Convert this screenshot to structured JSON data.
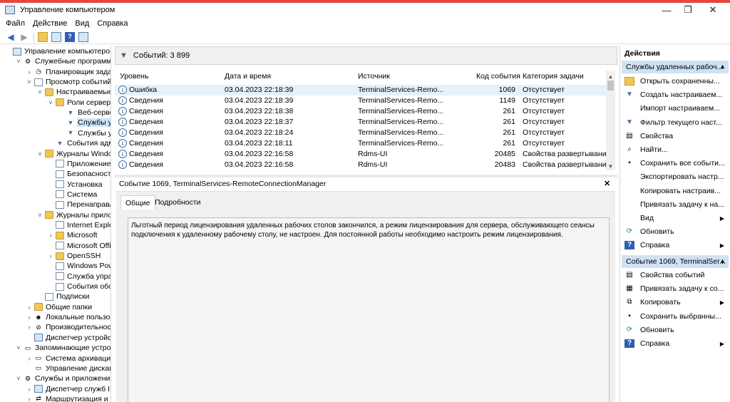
{
  "window": {
    "title": "Управление компьютером",
    "controls": {
      "minimize": "—",
      "maximize": "❐",
      "close": "✕"
    }
  },
  "menu": [
    "Файл",
    "Действие",
    "Вид",
    "Справка"
  ],
  "tree": [
    {
      "label": "Управление компьютером (л",
      "depth": 0,
      "twisty": "",
      "icon": "comp"
    },
    {
      "label": "Служебные программы",
      "depth": 1,
      "twisty": "˅",
      "icon": "tool"
    },
    {
      "label": "Планировщик заданий",
      "depth": 2,
      "twisty": "›",
      "icon": "clock"
    },
    {
      "label": "Просмотр событий",
      "depth": 2,
      "twisty": "˅",
      "icon": "log"
    },
    {
      "label": "Настраиваемые пр",
      "depth": 3,
      "twisty": "˅",
      "icon": "folder"
    },
    {
      "label": "Роли сервера",
      "depth": 4,
      "twisty": "˅",
      "icon": "folder"
    },
    {
      "label": "Веб-сервер",
      "depth": 5,
      "twisty": "",
      "icon": "filter"
    },
    {
      "label": "Службы уда",
      "depth": 5,
      "twisty": "",
      "icon": "filter",
      "selected": true
    },
    {
      "label": "Службы уда",
      "depth": 5,
      "twisty": "",
      "icon": "filter"
    },
    {
      "label": "События админ",
      "depth": 4,
      "twisty": "",
      "icon": "filter"
    },
    {
      "label": "Журналы Windows",
      "depth": 3,
      "twisty": "˅",
      "icon": "folder"
    },
    {
      "label": "Приложение",
      "depth": 4,
      "twisty": "",
      "icon": "log"
    },
    {
      "label": "Безопасность",
      "depth": 4,
      "twisty": "",
      "icon": "log"
    },
    {
      "label": "Установка",
      "depth": 4,
      "twisty": "",
      "icon": "log"
    },
    {
      "label": "Система",
      "depth": 4,
      "twisty": "",
      "icon": "log"
    },
    {
      "label": "Перенаправлен",
      "depth": 4,
      "twisty": "",
      "icon": "log"
    },
    {
      "label": "Журналы приложе",
      "depth": 3,
      "twisty": "˅",
      "icon": "folder"
    },
    {
      "label": "Internet Explorer",
      "depth": 4,
      "twisty": "",
      "icon": "log"
    },
    {
      "label": "Microsoft",
      "depth": 4,
      "twisty": "›",
      "icon": "folder"
    },
    {
      "label": "Microsoft Office",
      "depth": 4,
      "twisty": "",
      "icon": "log"
    },
    {
      "label": "OpenSSH",
      "depth": 4,
      "twisty": "›",
      "icon": "folder"
    },
    {
      "label": "Windows Power",
      "depth": 4,
      "twisty": "",
      "icon": "log"
    },
    {
      "label": "Служба управл",
      "depth": 4,
      "twisty": "",
      "icon": "log"
    },
    {
      "label": "События обору",
      "depth": 4,
      "twisty": "",
      "icon": "log"
    },
    {
      "label": "Подписки",
      "depth": 3,
      "twisty": "",
      "icon": "log"
    },
    {
      "label": "Общие папки",
      "depth": 2,
      "twisty": "›",
      "icon": "folder"
    },
    {
      "label": "Локальные пользовате",
      "depth": 2,
      "twisty": "›",
      "icon": "users"
    },
    {
      "label": "Производительность",
      "depth": 2,
      "twisty": "›",
      "icon": "perf"
    },
    {
      "label": "Диспетчер устройств",
      "depth": 2,
      "twisty": "",
      "icon": "comp"
    },
    {
      "label": "Запоминающие устройст",
      "depth": 1,
      "twisty": "˅",
      "icon": "disk"
    },
    {
      "label": "Система архивации да",
      "depth": 2,
      "twisty": "›",
      "icon": "disk"
    },
    {
      "label": "Управление дисками",
      "depth": 2,
      "twisty": "",
      "icon": "disk"
    },
    {
      "label": "Службы и приложения",
      "depth": 1,
      "twisty": "˅",
      "icon": "tool"
    },
    {
      "label": "Диспетчер служб IIS",
      "depth": 2,
      "twisty": "›",
      "icon": "comp"
    },
    {
      "label": "Маршрутизация и удал",
      "depth": 2,
      "twisty": "›",
      "icon": "net"
    }
  ],
  "events_header": {
    "count_label": "Событий: 3 899"
  },
  "columns": [
    "Уровень",
    "Дата и время",
    "Источник",
    "Код события",
    "Категория задачи"
  ],
  "events": [
    {
      "level": "Ошибка",
      "date": "03.04.2023 22:18:39",
      "source": "TerminalServices-Remo...",
      "code": "1069",
      "category": "Отсутствует",
      "selected": true
    },
    {
      "level": "Сведения",
      "date": "03.04.2023 22:18:39",
      "source": "TerminalServices-Remo...",
      "code": "1149",
      "category": "Отсутствует"
    },
    {
      "level": "Сведения",
      "date": "03.04.2023 22:18:38",
      "source": "TerminalServices-Remo...",
      "code": "261",
      "category": "Отсутствует"
    },
    {
      "level": "Сведения",
      "date": "03.04.2023 22:18:37",
      "source": "TerminalServices-Remo...",
      "code": "261",
      "category": "Отсутствует"
    },
    {
      "level": "Сведения",
      "date": "03.04.2023 22:18:24",
      "source": "TerminalServices-Remo...",
      "code": "261",
      "category": "Отсутствует"
    },
    {
      "level": "Сведения",
      "date": "03.04.2023 22:18:11",
      "source": "TerminalServices-Remo...",
      "code": "261",
      "category": "Отсутствует"
    },
    {
      "level": "Сведения",
      "date": "03.04.2023 22:16:58",
      "source": "Rdms-UI",
      "code": "20485",
      "category": "Свойства развертывания"
    },
    {
      "level": "Сведения",
      "date": "03.04.2023 22:16:58",
      "source": "Rdms-UI",
      "code": "20483",
      "category": "Свойства развертывания"
    }
  ],
  "detail": {
    "title": "Событие 1069, TerminalServices-RemoteConnectionManager",
    "close": "✕",
    "tabs": [
      "Общие",
      "Подробности"
    ],
    "description": "Льготный период лицензирования удаленных рабочих столов закончился, а режим лицензирования для сервера, обслуживающего сеансы подключения к удаленному рабочему столу, не настроен. Для постоянной работы необходимо настроить режим лицензирования."
  },
  "actions": {
    "title": "Действия",
    "section1": "Службы удаленных рабоч...",
    "items1": [
      {
        "label": "Открыть сохраненны...",
        "icon": "folder-open"
      },
      {
        "label": "Создать настраиваем...",
        "icon": "filter"
      },
      {
        "label": "Импорт настраиваем...",
        "icon": ""
      },
      {
        "label": "Фильтр текущего наст...",
        "icon": "filter"
      },
      {
        "label": "Свойства",
        "icon": "properties"
      },
      {
        "label": "Найти...",
        "icon": "binoculars"
      },
      {
        "label": "Сохранить все событи...",
        "icon": "save"
      },
      {
        "label": "Экспортировать настр...",
        "icon": ""
      },
      {
        "label": "Копировать настраив...",
        "icon": ""
      },
      {
        "label": "Привязать задачу к на...",
        "icon": ""
      },
      {
        "label": "Вид",
        "icon": "",
        "submenu": true
      },
      {
        "label": "Обновить",
        "icon": "refresh"
      },
      {
        "label": "Справка",
        "icon": "help",
        "submenu": true
      }
    ],
    "section2": "Событие 1069, TerminalSer...",
    "items2": [
      {
        "label": "Свойства событий",
        "icon": "properties"
      },
      {
        "label": "Привязать задачу к со...",
        "icon": "task"
      },
      {
        "label": "Копировать",
        "icon": "copy",
        "submenu": true
      },
      {
        "label": "Сохранить выбранны...",
        "icon": "save"
      },
      {
        "label": "Обновить",
        "icon": "refresh"
      },
      {
        "label": "Справка",
        "icon": "help",
        "submenu": true
      }
    ]
  },
  "colors": {
    "accent_strip": "#e8463a",
    "selection": "#cce4f7",
    "section_header": "#cfe2f3"
  }
}
